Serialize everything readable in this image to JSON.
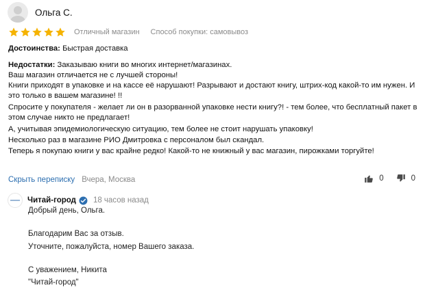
{
  "review": {
    "author": "Ольга С.",
    "rating": 5,
    "rating_label": "Отличный магазин",
    "purchase_method": "Способ покупки: самовывоз",
    "pros_label": "Достоинства:",
    "pros_text": " Быстрая доставка",
    "cons_label": "Недостатки:",
    "cons_lines": [
      " Заказываю книги во многих интернет/магазинах.",
      "Ваш магазин отличается не с лучшей стороны!",
      "Книги приходят в упаковке и на кассе её нарушают! Разрывают и достают книгу, штрих-код какой-то им нужен. И",
      "это только в вашем магазине! !!",
      "Спросите у покупателя - желает ли он в разорванной упаковке нести книгу?! - тем более, что бесплатный пакет в",
      "этом случае никто не предлагает!",
      "А, учитывая эпидемиологическую ситуацию, тем более не стоит нарушать упаковку!",
      "Несколько раз в магазине РИО Дмитровка с персоналом был скандал.",
      "Теперь я покупаю книги у вас крайне редко! Какой-то не книжный у вас магазин, пирожками торгуйте!"
    ],
    "hide_thread": "Скрыть переписку",
    "date": "Вчера, Москва",
    "likes": "0",
    "dislikes": "0"
  },
  "reply": {
    "shop_name": "Читай-город",
    "time": "18 часов назад",
    "lines": [
      "Добрый день, Ольга.",
      "Благодарим Вас за отзыв.",
      "Уточните, пожалуйста, номер Вашего заказа.",
      "С уважением, Никита",
      "\"Читай-город\""
    ]
  },
  "colors": {
    "star": "#f5b301",
    "link": "#2d6fb0",
    "verified": "#2d6fb0",
    "muted": "#8a8a8a"
  }
}
